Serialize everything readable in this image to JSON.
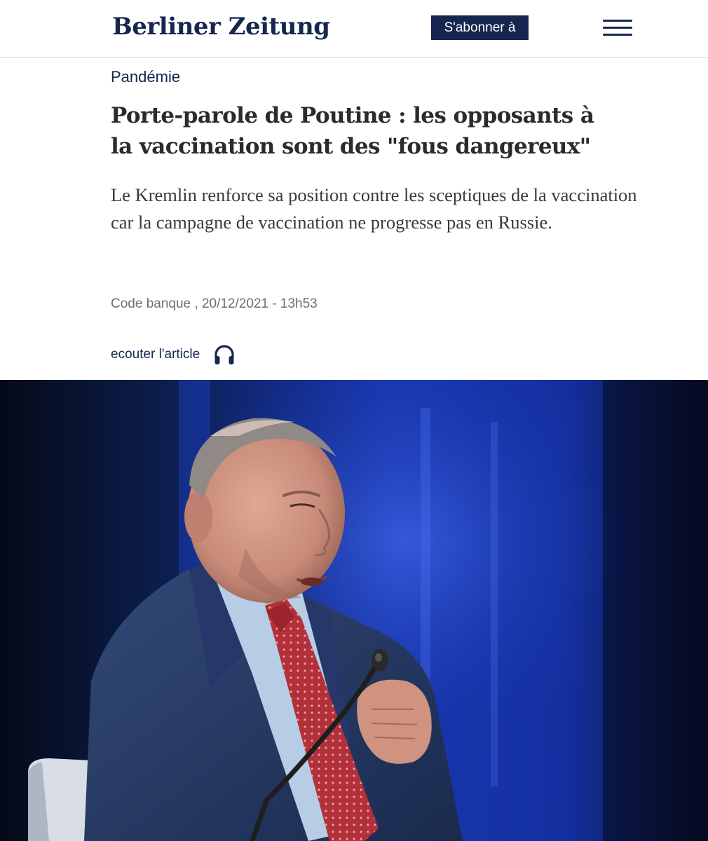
{
  "header": {
    "logo_text": "Berliner Zeitung",
    "subscribe_label": "S'abonner à",
    "menu_icon": "hamburger-menu-icon",
    "brand_color": "#16264f"
  },
  "article": {
    "category": "Pandémie",
    "headline": "Porte-parole de Poutine : les opposants à la vaccination sont des \"fous dangereux\"",
    "lead": "Le Kremlin renforce sa position contre les sceptiques de la vaccination car la campagne de vaccination ne progresse pas en Russie.",
    "meta": "Code banque , 20/12/2021 - 13h53",
    "listen_label": "ecouter l'article",
    "listen_icon": "headphones-icon"
  },
  "hero_image": {
    "subject": "photo-of-speaker-at-microphone"
  }
}
